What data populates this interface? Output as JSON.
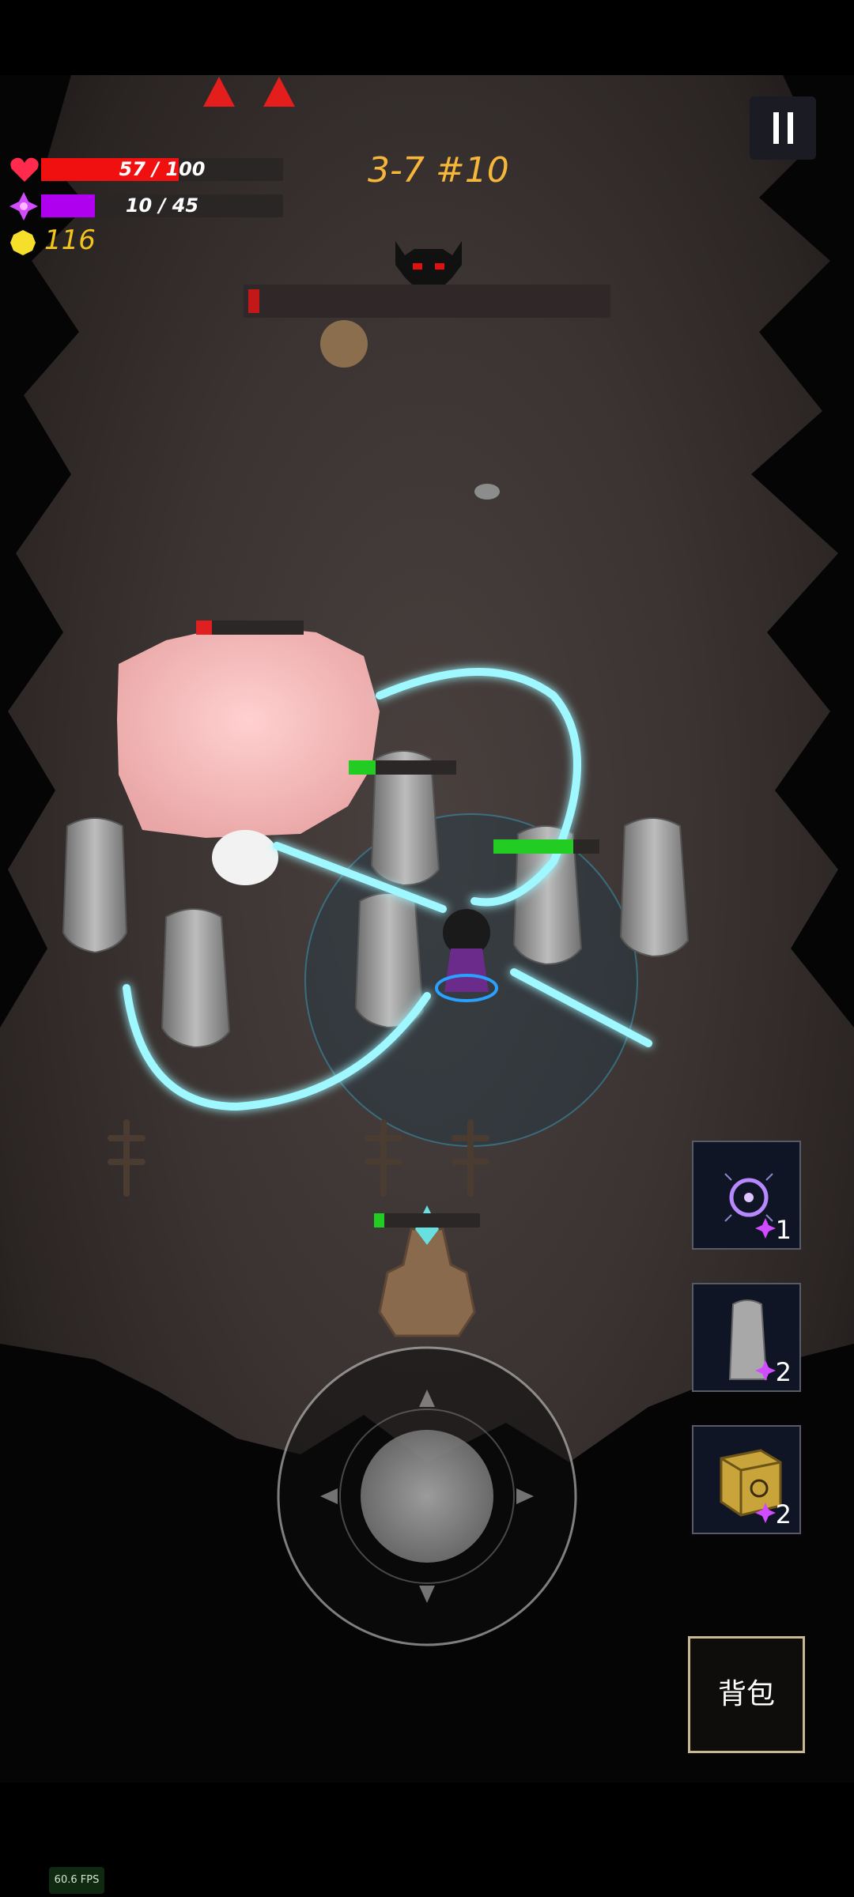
{
  "hud": {
    "hp_text": "57 / 100",
    "hp_fraction": 0.57,
    "mp_text": "10 / 45",
    "mp_fraction": 0.222,
    "gold": "116",
    "stage": "3-7 #10",
    "boss_hp_fraction": 0.03
  },
  "enemies": [
    {
      "name": "pink-blob",
      "hp_fraction": 0.15,
      "color": "#e02020"
    },
    {
      "name": "statue-a",
      "hp_fraction": 0.25,
      "color": "#22cc22"
    },
    {
      "name": "statue-b",
      "hp_fraction": 0.75,
      "color": "#22cc22"
    },
    {
      "name": "totem",
      "hp_fraction": 0.1,
      "color": "#22cc22"
    }
  ],
  "skills": [
    {
      "icon": "vortex-orb-icon",
      "cost": "1"
    },
    {
      "icon": "moai-statue-icon",
      "cost": "2"
    },
    {
      "icon": "rune-cube-icon",
      "cost": "2"
    }
  ],
  "buttons": {
    "bag_label": "背包",
    "pause_icon": "pause-icon"
  },
  "debug": {
    "fps": "60.6 FPS"
  },
  "colors": {
    "hp": "#f01010",
    "mana": "#b000f0",
    "gold": "#f3c51c",
    "stage_text": "#f5b63a",
    "lightning": "#7ff6ff"
  }
}
